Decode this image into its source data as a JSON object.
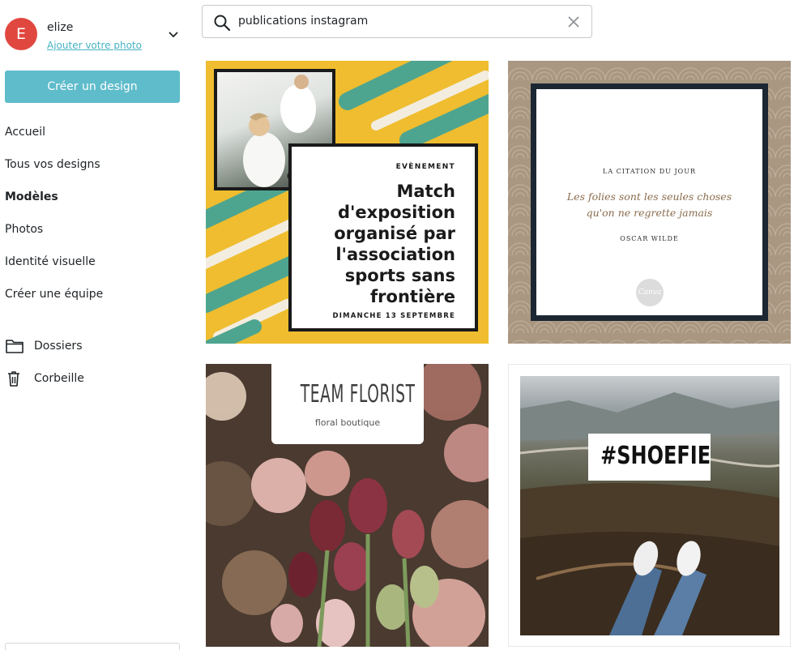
{
  "account": {
    "initial": "E",
    "name": "elize",
    "add_photo": "Ajouter votre photo"
  },
  "sidebar": {
    "create_button": "Créer un design",
    "nav": [
      {
        "label": "Accueil",
        "active": false
      },
      {
        "label": "Tous vos designs",
        "active": false
      },
      {
        "label": "Modèles",
        "active": true
      },
      {
        "label": "Photos",
        "active": false
      },
      {
        "label": "Identité visuelle",
        "active": false
      },
      {
        "label": "Créer une équipe",
        "active": false
      }
    ],
    "folders_label": "Dossiers",
    "trash_label": "Corbeille"
  },
  "search": {
    "value": "publications instagram"
  },
  "templates": [
    {
      "event_label": "EVÈNEMENT",
      "title": "Match d'exposition organisé par l'association sports sans frontière",
      "date": "DIMANCHE 13 SEPTEMBRE"
    },
    {
      "heading": "LA CITATION DU JOUR",
      "quote": "Les folies sont les seules choses qu'on ne regrette jamais",
      "author": "OSCAR WILDE",
      "logo": "Canva"
    },
    {
      "title": "TEAM FLORIST",
      "subtitle": "floral boutique"
    },
    {
      "tag": "#SHOEFIE"
    }
  ],
  "colors": {
    "accent": "#5fbccb",
    "avatar": "#e0483f",
    "link": "#46b3c4"
  }
}
